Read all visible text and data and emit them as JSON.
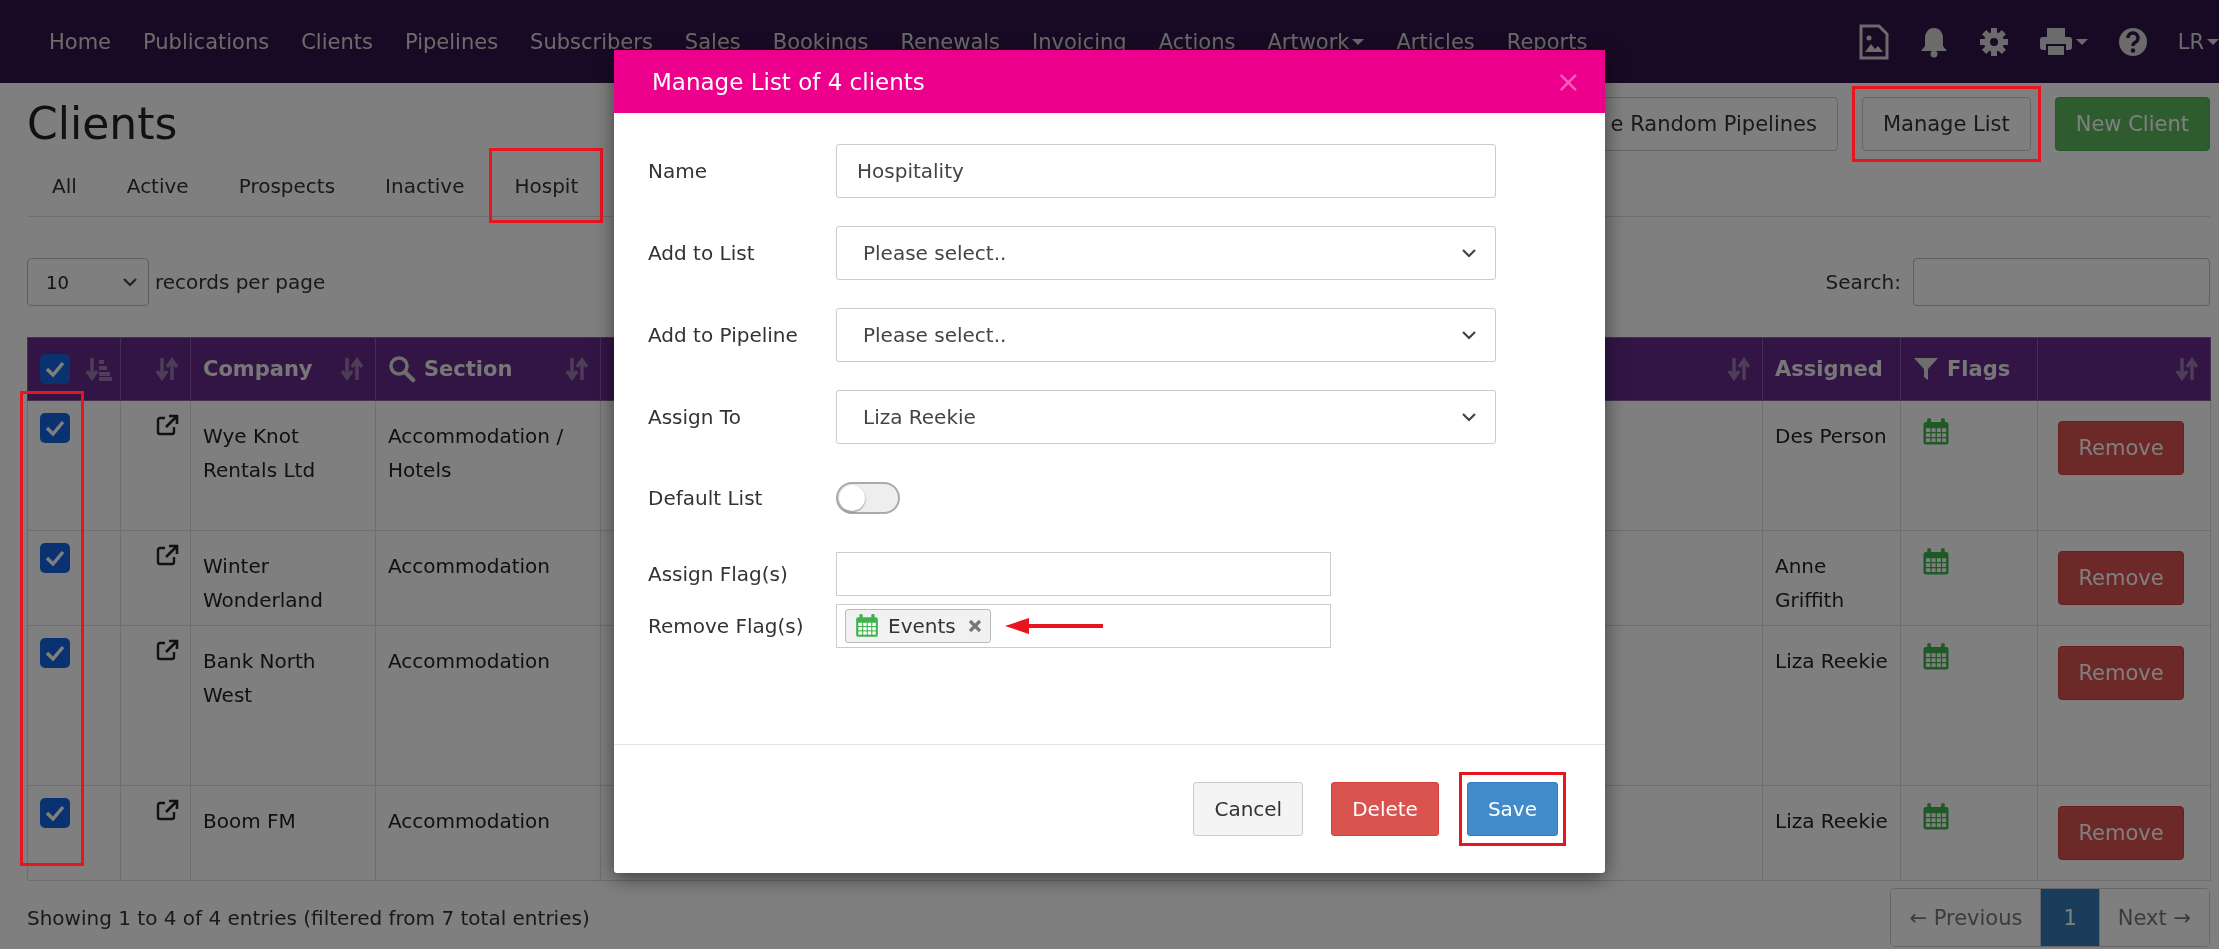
{
  "nav": {
    "items": [
      {
        "label": "Home",
        "dropdown": false
      },
      {
        "label": "Publications",
        "dropdown": false
      },
      {
        "label": "Clients",
        "dropdown": false
      },
      {
        "label": "Pipelines",
        "dropdown": false
      },
      {
        "label": "Subscribers",
        "dropdown": false
      },
      {
        "label": "Sales",
        "dropdown": false
      },
      {
        "label": "Bookings",
        "dropdown": false
      },
      {
        "label": "Renewals",
        "dropdown": false
      },
      {
        "label": "Invoicing",
        "dropdown": false
      },
      {
        "label": "Actions",
        "dropdown": false
      },
      {
        "label": "Artwork",
        "dropdown": true
      },
      {
        "label": "Articles",
        "dropdown": false
      },
      {
        "label": "Reports",
        "dropdown": false
      }
    ],
    "user": "LR"
  },
  "page": {
    "title": "Clients",
    "buttons": [
      {
        "label": "e Random Pipelines",
        "kind": "default",
        "highlighted": false
      },
      {
        "label": "Manage List",
        "kind": "default",
        "highlighted": true
      },
      {
        "label": "New Client",
        "kind": "success",
        "highlighted": false
      }
    ]
  },
  "tabs": [
    {
      "label": "All",
      "selected": false,
      "highlighted": false
    },
    {
      "label": "Active",
      "selected": false,
      "highlighted": false
    },
    {
      "label": "Prospects",
      "selected": false,
      "highlighted": false
    },
    {
      "label": "Inactive",
      "selected": false,
      "highlighted": false
    },
    {
      "label": "Hospit",
      "selected": false,
      "highlighted": true
    }
  ],
  "length_select": {
    "value": "10",
    "label": "records per page"
  },
  "search": {
    "label": "Search:"
  },
  "table": {
    "all_checked": true,
    "checkbox_column_highlighted": true,
    "columns": [
      {
        "label": "Company",
        "kind": "sortable"
      },
      {
        "label": "Section",
        "kind": "search"
      },
      {
        "label": "Assigned",
        "kind": "plain"
      },
      {
        "label": "Flags",
        "kind": "filter"
      }
    ],
    "rows": [
      {
        "checked": true,
        "company": "Wye Knot Rentals Ltd",
        "section": "Accommodation / Hotels",
        "assigned": "Des Person",
        "action": "Remove"
      },
      {
        "checked": true,
        "company": "Winter Wonderland",
        "section": "Accommodation",
        "assigned": "Anne Griffith",
        "action": "Remove"
      },
      {
        "checked": true,
        "company": "Bank North West",
        "section": "Accommodation",
        "assigned": "Liza Reekie",
        "action": "Remove"
      },
      {
        "checked": true,
        "company": "Boom FM",
        "section": "Accommodation",
        "assigned": "Liza Reekie",
        "action": "Remove"
      }
    ]
  },
  "footer": {
    "info": "Showing 1 to 4 of 4 entries (filtered from 7 total entries)",
    "pagination": [
      {
        "label": "← Previous",
        "selected": false,
        "disabled": true
      },
      {
        "label": "1",
        "selected": true,
        "disabled": false
      },
      {
        "label": "Next →",
        "selected": false,
        "disabled": true
      }
    ]
  },
  "modal": {
    "title": "Manage List of 4 clients",
    "close": "×",
    "fields": [
      {
        "kind": "text",
        "label": "Name",
        "value": "Hospitality"
      },
      {
        "kind": "select",
        "label": "Add to List",
        "value": "Please select.."
      },
      {
        "kind": "select",
        "label": "Add to Pipeline",
        "value": "Please select.."
      },
      {
        "kind": "select",
        "label": "Assign To",
        "value": "Liza Reekie"
      },
      {
        "kind": "toggle",
        "label": "Default List",
        "on": false
      },
      {
        "kind": "tags",
        "label": "Assign Flag(s)"
      },
      {
        "kind": "tags",
        "label": "Remove Flag(s)",
        "tags": [
          {
            "label": "Events",
            "annotated": true
          }
        ]
      }
    ],
    "buttons": [
      {
        "label": "Cancel",
        "kind": "default",
        "highlighted": false
      },
      {
        "label": "Delete",
        "kind": "danger",
        "highlighted": false
      },
      {
        "label": "Save",
        "kind": "primary",
        "highlighted": true
      }
    ]
  }
}
